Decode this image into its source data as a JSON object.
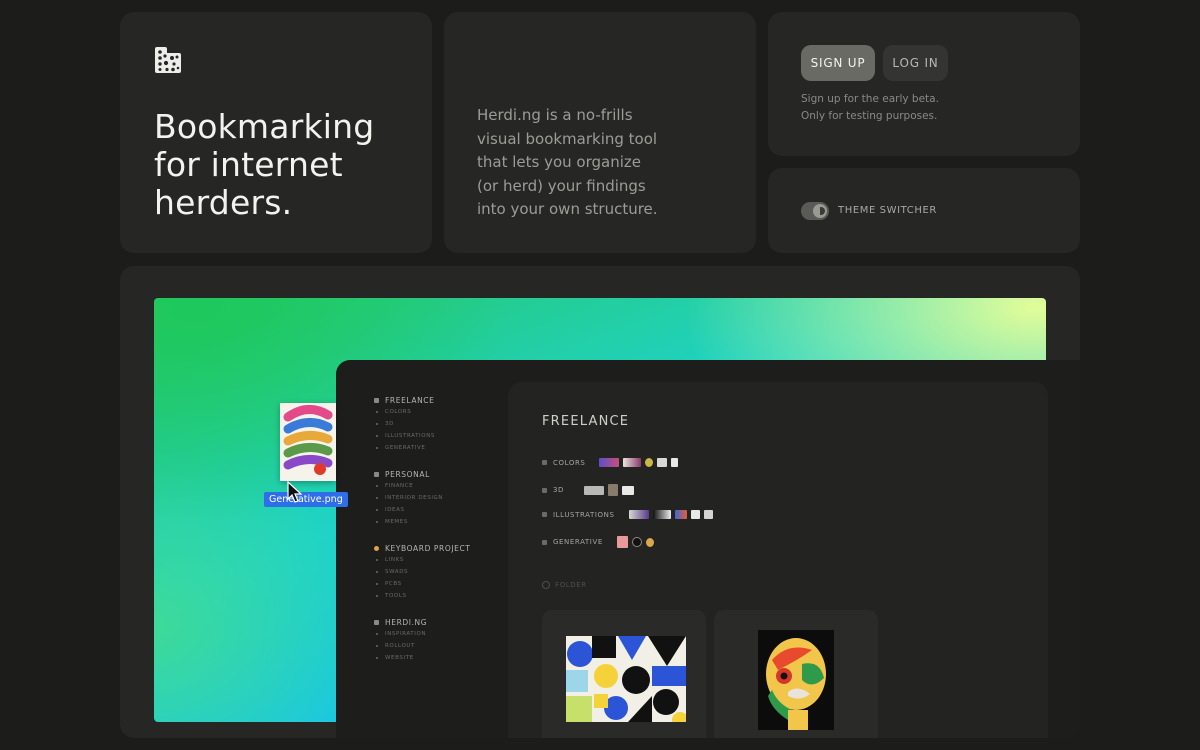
{
  "hero": {
    "logo_icon": "herd-dots-icon",
    "title_lines": [
      "Bookmarking",
      "for internet",
      "herders."
    ]
  },
  "description": {
    "lines": [
      "Herdi.ng is a no-frills",
      "visual bookmarking tool",
      "that lets you organize",
      "(or herd) your findings",
      "into your own structure."
    ]
  },
  "auth": {
    "signup_label": "SIGN UP",
    "login_label": "LOG IN",
    "note_lines": [
      "Sign up for the early beta.",
      "Only for testing purposes."
    ]
  },
  "theme": {
    "switcher_label": "THEME SWITCHER",
    "toggle_icon": "moon-toggle-icon"
  },
  "preview": {
    "drag_file_label": "Generative.png",
    "sidebar": [
      {
        "title": "FREELANCE",
        "items": [
          "COLORS",
          "3D",
          "ILLUSTRATIONS",
          "GENERATIVE"
        ]
      },
      {
        "title": "PERSONAL",
        "items": [
          "FINANCE",
          "INTERIOR DESIGN",
          "IDEAS",
          "MEMES"
        ]
      },
      {
        "title": "KEYBOARD PROJECT",
        "items": [
          "LINKS",
          "SWADS",
          "PCBS",
          "TOOLS"
        ]
      },
      {
        "title": "HERDI.NG",
        "items": [
          "INSPIRATION",
          "ROLLOUT",
          "WEBSITE"
        ]
      }
    ],
    "panel": {
      "title": "FREELANCE",
      "rows": [
        "COLORS",
        "3D",
        "ILLUSTRATIONS",
        "GENERATIVE"
      ],
      "add_folder": "FOLDER"
    },
    "colors": {
      "accent_blue": "#2f6ee8",
      "keyboard_dot": "#e3a14a"
    }
  }
}
